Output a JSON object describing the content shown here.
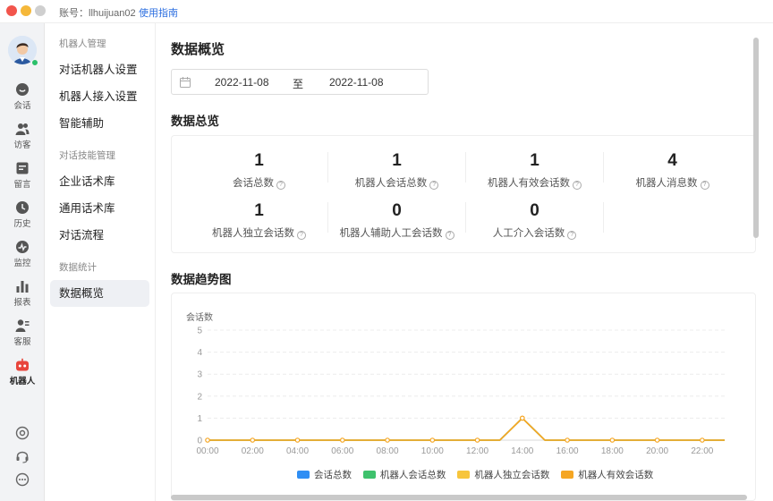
{
  "titlebar": {
    "account": "账号：llhuijuan02",
    "guide": "使用指南"
  },
  "rail": {
    "items": [
      {
        "label": "会话",
        "icon": "chat-icon"
      },
      {
        "label": "访客",
        "icon": "visitors-icon"
      },
      {
        "label": "留言",
        "icon": "message-icon"
      },
      {
        "label": "历史",
        "icon": "history-icon"
      },
      {
        "label": "监控",
        "icon": "monitor-icon"
      },
      {
        "label": "报表",
        "icon": "report-icon"
      },
      {
        "label": "客服",
        "icon": "agent-icon"
      },
      {
        "label": "机器人",
        "icon": "robot-icon"
      }
    ],
    "bottom": [
      "settings-icon",
      "headset-icon",
      "more-icon"
    ],
    "accent": "#e8453c"
  },
  "subnav": {
    "groups": [
      {
        "title": "机器人管理",
        "items": [
          "对话机器人设置",
          "机器人接入设置",
          "智能辅助"
        ]
      },
      {
        "title": "对话技能管理",
        "items": [
          "企业话术库",
          "通用话术库",
          "对话流程"
        ]
      },
      {
        "title": "数据统计",
        "items": [
          "数据概览"
        ]
      }
    ],
    "active": "数据概览"
  },
  "main": {
    "title": "数据概览",
    "date_range": {
      "start": "2022-11-08",
      "separator": "至",
      "end": "2022-11-08"
    },
    "summary_title": "数据总览",
    "stats": [
      {
        "value": "1",
        "label": "会话总数"
      },
      {
        "value": "1",
        "label": "机器人会话总数"
      },
      {
        "value": "1",
        "label": "机器人有效会话数"
      },
      {
        "value": "4",
        "label": "机器人消息数"
      },
      {
        "value": "1",
        "label": "机器人独立会话数"
      },
      {
        "value": "0",
        "label": "机器人辅助人工会话数"
      },
      {
        "value": "0",
        "label": "人工介入会话数"
      }
    ],
    "trend_title": "数据趋势图"
  },
  "chart_data": {
    "type": "line",
    "ylabel": "会话数",
    "ylim": [
      0,
      5
    ],
    "yticks": [
      "0",
      "1",
      "2",
      "3",
      "4",
      "5"
    ],
    "x": [
      "00:00",
      "01:00",
      "02:00",
      "03:00",
      "04:00",
      "05:00",
      "06:00",
      "07:00",
      "08:00",
      "09:00",
      "10:00",
      "11:00",
      "12:00",
      "13:00",
      "14:00",
      "15:00",
      "16:00",
      "17:00",
      "18:00",
      "19:00",
      "20:00",
      "21:00",
      "22:00",
      "23:00"
    ],
    "xtick_labels": [
      "00:00",
      "02:00",
      "04:00",
      "06:00",
      "08:00",
      "10:00",
      "12:00",
      "14:00",
      "16:00",
      "18:00",
      "20:00",
      "22:00"
    ],
    "series": [
      {
        "name": "会话总数",
        "color": "#2f8ef4",
        "values": [
          0,
          0,
          0,
          0,
          0,
          0,
          0,
          0,
          0,
          0,
          0,
          0,
          0,
          0,
          1,
          0,
          0,
          0,
          0,
          0,
          0,
          0,
          0,
          0
        ]
      },
      {
        "name": "机器人会话总数",
        "color": "#3fc26d",
        "values": [
          0,
          0,
          0,
          0,
          0,
          0,
          0,
          0,
          0,
          0,
          0,
          0,
          0,
          0,
          1,
          0,
          0,
          0,
          0,
          0,
          0,
          0,
          0,
          0
        ]
      },
      {
        "name": "机器人独立会话数",
        "color": "#f7c53c",
        "values": [
          0,
          0,
          0,
          0,
          0,
          0,
          0,
          0,
          0,
          0,
          0,
          0,
          0,
          0,
          1,
          0,
          0,
          0,
          0,
          0,
          0,
          0,
          0,
          0
        ]
      },
      {
        "name": "机器人有效会话数",
        "color": "#f5a623",
        "values": [
          0,
          0,
          0,
          0,
          0,
          0,
          0,
          0,
          0,
          0,
          0,
          0,
          0,
          0,
          1,
          0,
          0,
          0,
          0,
          0,
          0,
          0,
          0,
          0
        ]
      }
    ],
    "grid": true,
    "legend": "bottom"
  }
}
